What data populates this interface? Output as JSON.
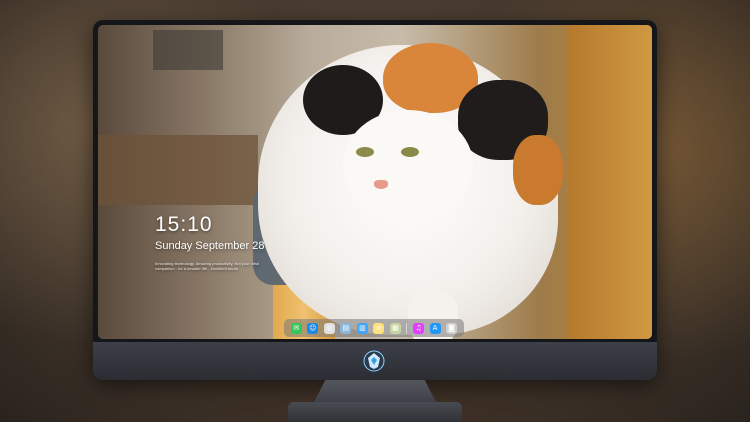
{
  "lockscreen": {
    "time": "15:10",
    "date": "Sunday September 28",
    "tagline": "Innovating technology. Amazing productivity. Not your ideal companion - for a smarter life - Excellent future"
  },
  "dock": {
    "apps": [
      {
        "icon": "messages-icon",
        "color": "#34c759",
        "glyph": "✉"
      },
      {
        "icon": "finder-icon",
        "color": "#1e88e5",
        "glyph": "☺"
      },
      {
        "icon": "safari-icon",
        "color": "#e0e0e0",
        "glyph": "◎"
      },
      {
        "icon": "photos-icon",
        "color": "#8bb7d8",
        "glyph": "▤"
      },
      {
        "icon": "files-icon",
        "color": "#42a5f5",
        "glyph": "▥"
      },
      {
        "icon": "notes-icon",
        "color": "#ffe27a",
        "glyph": "≡"
      },
      {
        "icon": "preview-icon",
        "color": "#c9d6a3",
        "glyph": "▦"
      },
      {
        "icon": "music-icon",
        "color": "#e040fb",
        "glyph": "♫"
      },
      {
        "icon": "app-store-icon",
        "color": "#2196f3",
        "glyph": "A"
      },
      {
        "icon": "camera-icon",
        "color": "#cfcfcf",
        "glyph": "◙"
      }
    ]
  },
  "monitor": {
    "logo_icon": "brand-logo-icon"
  }
}
